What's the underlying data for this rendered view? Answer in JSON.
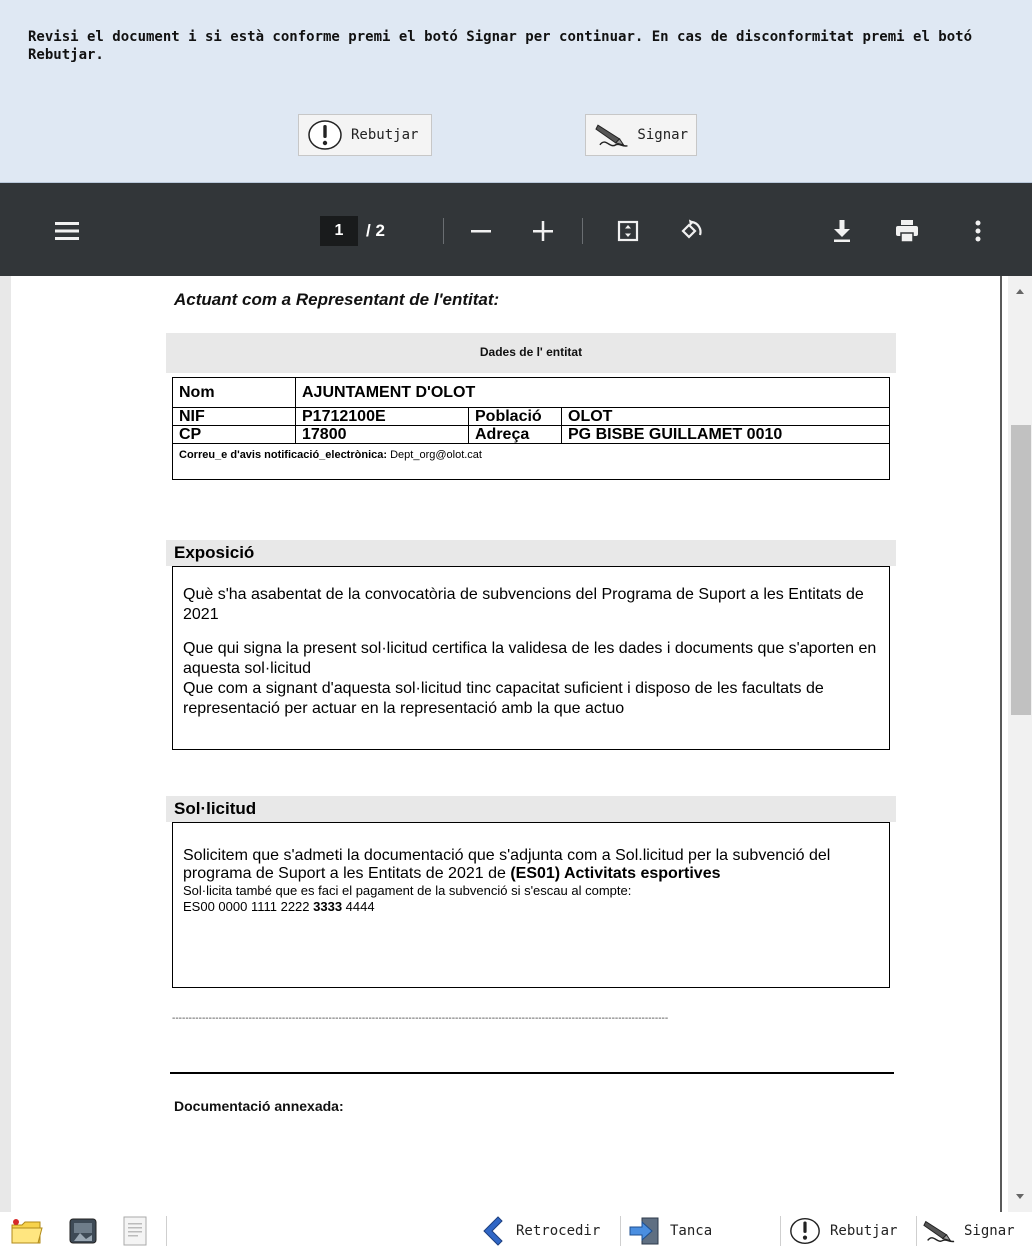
{
  "instructions": "Revisi el document i si està conforme premi el botó Signar per continuar. En cas de disconformitat premi el botó Rebutjar.",
  "top_buttons": {
    "reject": "Rebutjar",
    "sign": "Signar"
  },
  "pdf_toolbar": {
    "current_page": "1",
    "page_separator": "/",
    "total_pages": "2"
  },
  "document": {
    "representative_title": "Actuant com a Representant de l'entitat:",
    "entity_header": "Dades de l' entitat",
    "entity": {
      "nom_label": "Nom",
      "nom_value": "AJUNTAMENT D'OLOT",
      "nif_label": "NIF",
      "nif_value": "P1712100E",
      "poblacio_label": "Població",
      "poblacio_value": "OLOT",
      "cp_label": "CP",
      "cp_value": "17800",
      "adreca_label": "Adreça",
      "adreca_value": "PG BISBE GUILLAMET  0010",
      "email_label": "Correu_e d'avis notificació_electrònica:",
      "email_value": "Dept_org@olot.cat"
    },
    "exposicio_title": "Exposició",
    "exposicio_p1": "Què s'ha asabentat de la convocatòria de subvencions del Programa de Suport a les Entitats de 2021",
    "exposicio_p2": "Que qui signa la present sol·licitud  certifica la validesa de les dades i documents que s'aporten en aquesta sol·licitud",
    "exposicio_p3": "Que com a signant d'aquesta sol·licitud tinc capacitat suficient i disposo de les facultats de representació per actuar en  la representació amb la que actuo",
    "solicitud_title": "Sol·licitud",
    "solicitud_p1a": "Solicitem que s'admeti la documentació que s'adjunta com a Sol.licitud per la subvenció del programa de Suport a les Entitats de 2021 de ",
    "solicitud_p1b": "(ES01) Activitats esportives",
    "solicitud_p2": "Sol·licita també  que es faci el pagament de la subvenció si s'escau al compte:",
    "account_a": "ES00 0000 1111 2222 ",
    "account_b": "3333",
    "account_c": " 4444",
    "dashes": "-----------------------------------------------------------------------------------------------------------------------------------------------------",
    "annex_title": "Documentació annexada:"
  },
  "bottom_bar": {
    "back": "Retrocedir",
    "close": "Tanca",
    "reject": "Rebutjar",
    "sign": "Signar"
  },
  "colors": {
    "toolbar": "#323639",
    "top_panel": "#dfe8f3"
  }
}
